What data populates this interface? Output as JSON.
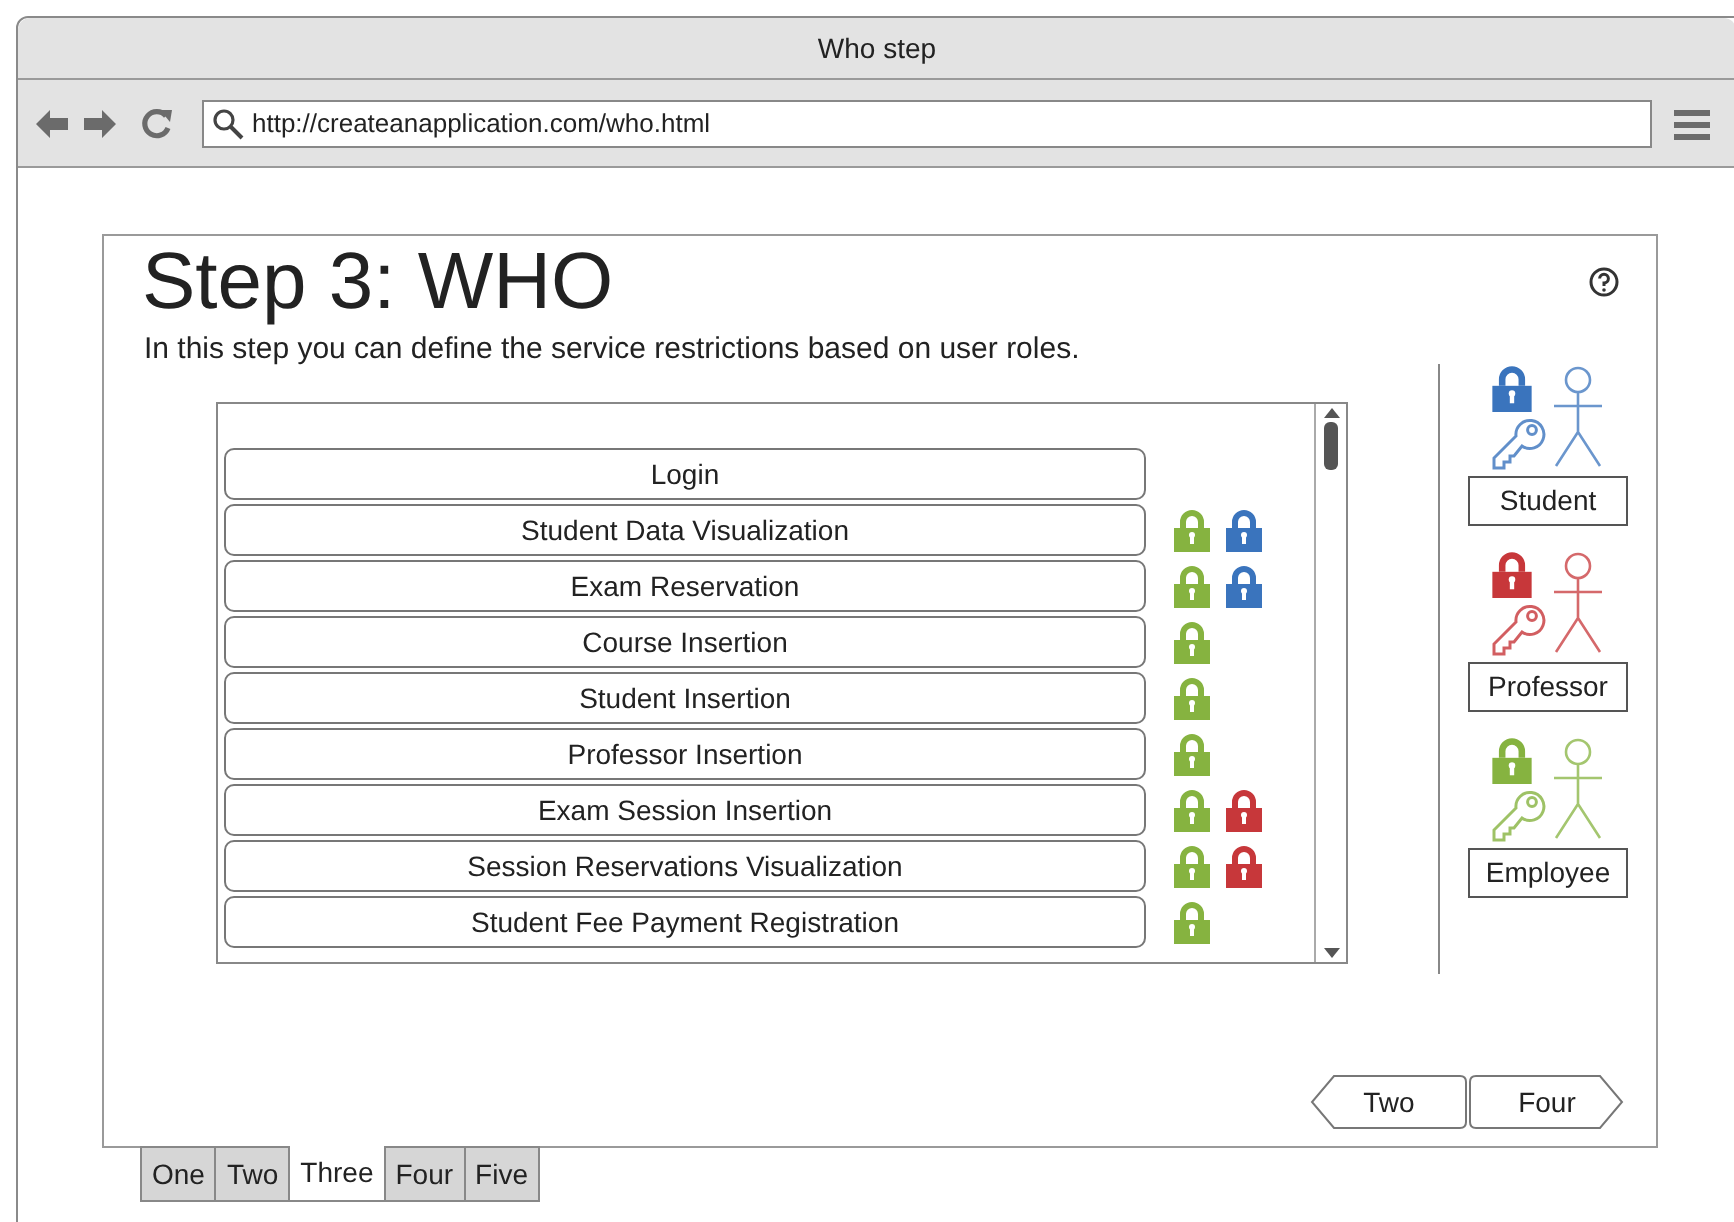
{
  "window": {
    "title": "Who step"
  },
  "toolbar": {
    "url": "http://createanapplication.com/who.html"
  },
  "page": {
    "title": "Step 3: WHO",
    "subtitle": "In this step you can define the service restrictions based on user roles."
  },
  "services": [
    {
      "label": "Login"
    },
    {
      "label": "Student Data Visualization",
      "locks": [
        {
          "color": "#86b340"
        },
        {
          "color": "#3a74bd"
        }
      ]
    },
    {
      "label": "Exam Reservation",
      "locks": [
        {
          "color": "#86b340"
        },
        {
          "color": "#3a74bd"
        }
      ]
    },
    {
      "label": "Course Insertion",
      "locks": [
        {
          "color": "#86b340"
        }
      ]
    },
    {
      "label": "Student Insertion",
      "locks": [
        {
          "color": "#86b340"
        }
      ]
    },
    {
      "label": "Professor Insertion",
      "locks": [
        {
          "color": "#86b340"
        }
      ]
    },
    {
      "label": "Exam Session Insertion",
      "locks": [
        {
          "color": "#86b340"
        },
        {
          "color": "#c7373a"
        }
      ]
    },
    {
      "label": "Session Reservations Visualization",
      "locks": [
        {
          "color": "#86b340"
        },
        {
          "color": "#c7373a"
        }
      ]
    },
    {
      "label": "Student Fee Payment Registration",
      "locks": [
        {
          "color": "#86b340"
        }
      ]
    }
  ],
  "roles": [
    {
      "label": "Student",
      "color": "#3a74bd"
    },
    {
      "label": "Professor",
      "color": "#c7373a"
    },
    {
      "label": "Employee",
      "color": "#86b340"
    }
  ],
  "nav_buttons": [
    {
      "label": "Two",
      "kind": "back"
    },
    {
      "label": "Four",
      "kind": "next"
    }
  ],
  "tabs": [
    {
      "label": "One",
      "selected": false
    },
    {
      "label": "Two",
      "selected": false
    },
    {
      "label": "Three",
      "selected": true
    },
    {
      "label": "Four",
      "selected": false
    },
    {
      "label": "Five",
      "selected": false
    }
  ]
}
